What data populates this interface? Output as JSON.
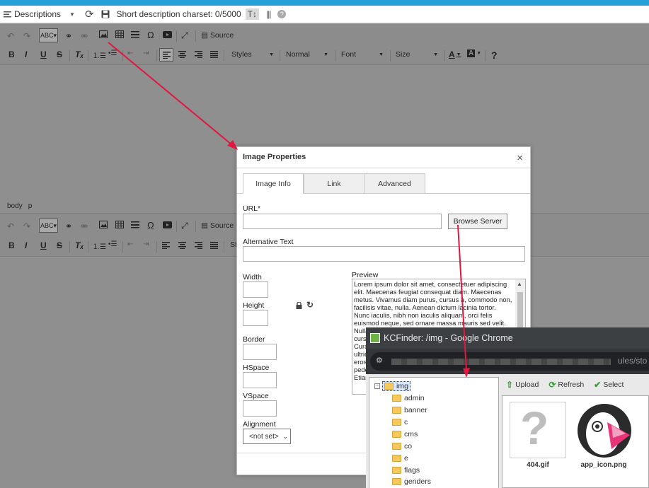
{
  "header": {
    "descriptions_label": "Descriptions",
    "charset_label": "Short description charset: 0/5000"
  },
  "toolbar": {
    "source_label": "Source",
    "styles_label": "Styles",
    "format_label": "Normal",
    "font_label": "Font",
    "size_label": "Size",
    "bold": "B",
    "italic": "I",
    "underline": "U",
    "strike": "S",
    "help": "?",
    "omega": "Ω"
  },
  "editor2": {
    "styles_partial": "St"
  },
  "pathbar": {
    "body": "body",
    "p": "p"
  },
  "dialog": {
    "title": "Image Properties",
    "close": "×",
    "tabs": [
      "Image Info",
      "Link",
      "Advanced"
    ],
    "url_label": "URL",
    "required_mark": "*",
    "browse_button": "Browse Server",
    "alt_label": "Alternative Text",
    "width_label": "Width",
    "height_label": "Height",
    "border_label": "Border",
    "hspace_label": "HSpace",
    "vspace_label": "VSpace",
    "alignment_label": "Alignment",
    "alignment_value": "<not set>",
    "preview_label": "Preview",
    "preview_text": "Lorem ipsum dolor sit amet, consectetuer adipiscing elit. Maecenas feugiat consequat diam. Maecenas metus. Vivamus diam purus, cursus a, commodo non, facilisis vitae, nulla. Aenean dictum lacinia tortor. Nunc iaculis, nibh non iaculis aliquam, orci felis euismod neque, sed ornare massa mauris sed velit. Nulla pretium mi et risus. Fusce mi pede, tempor id, cursus ac, ullamcorper nec, enim. Sed tortor. Curabitur molestie. Duis velit augue, condimentum at, ultrices a, luctus ut, orci. Donec pellentesque egestas eros. Integer cursus, augue in cursus faucibus, eros pede bibendum sem, in tempus tellus justo quis ligula. Etiam eget tortor."
  },
  "kcfinder": {
    "window_title": "KCFinder: /img - Google Chrome",
    "url_suffix": "ules/sto",
    "root_folder": "img",
    "folders": [
      "admin",
      "banner",
      "c",
      "cms",
      "co",
      "e",
      "flags",
      "genders"
    ],
    "upload_label": "Upload",
    "refresh_label": "Refresh",
    "select_label": "Select",
    "files": [
      "404.gif",
      "app_icon.png"
    ]
  },
  "colors": {
    "accent": "#25a1d7",
    "annotation_arrow": "#e0173f"
  }
}
